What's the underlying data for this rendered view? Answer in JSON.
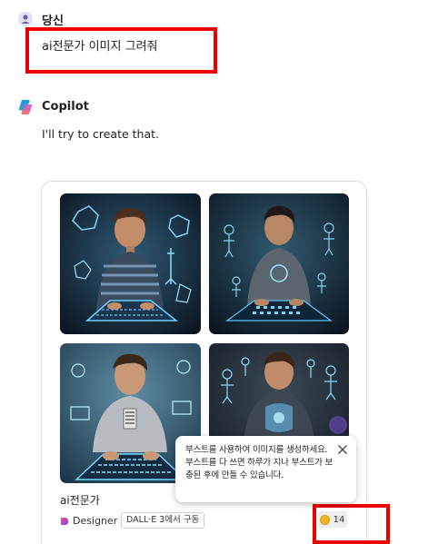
{
  "user": {
    "name": "당신",
    "message": "ai전문가 이미지 그려줘"
  },
  "copilot": {
    "name": "Copilot",
    "message": "I'll try to create that."
  },
  "image_card": {
    "title": "ai전문가",
    "designer_label": "Designer",
    "model_badge": "DALL·E 3에서 구동",
    "boost_count": "14",
    "images": [
      {
        "subject": "young man typing on glowing keyboard with holographic robots"
      },
      {
        "subject": "young man at glowing keyboard with holographic figures"
      },
      {
        "subject": "young man in grey t-shirt typing on blue keyboard"
      },
      {
        "subject": "young man among holographic humanoid figures"
      }
    ]
  },
  "tooltip": {
    "text": "부스트를 사용하여 이미지를 생성하세요. 부스트를 다 쓰면 하루가 지나 부스트가 보충된 후에 만들 수 있습니다."
  },
  "icons": {
    "avatar": "user-avatar-icon",
    "copilot": "copilot-logo-icon",
    "designer": "designer-logo-icon",
    "boost": "boost-coin-icon",
    "close": "close-icon"
  },
  "colors": {
    "highlight_box": "#ec0000",
    "avatar_bg": "#e6e0f5",
    "boost_coin": "#f0b429"
  }
}
